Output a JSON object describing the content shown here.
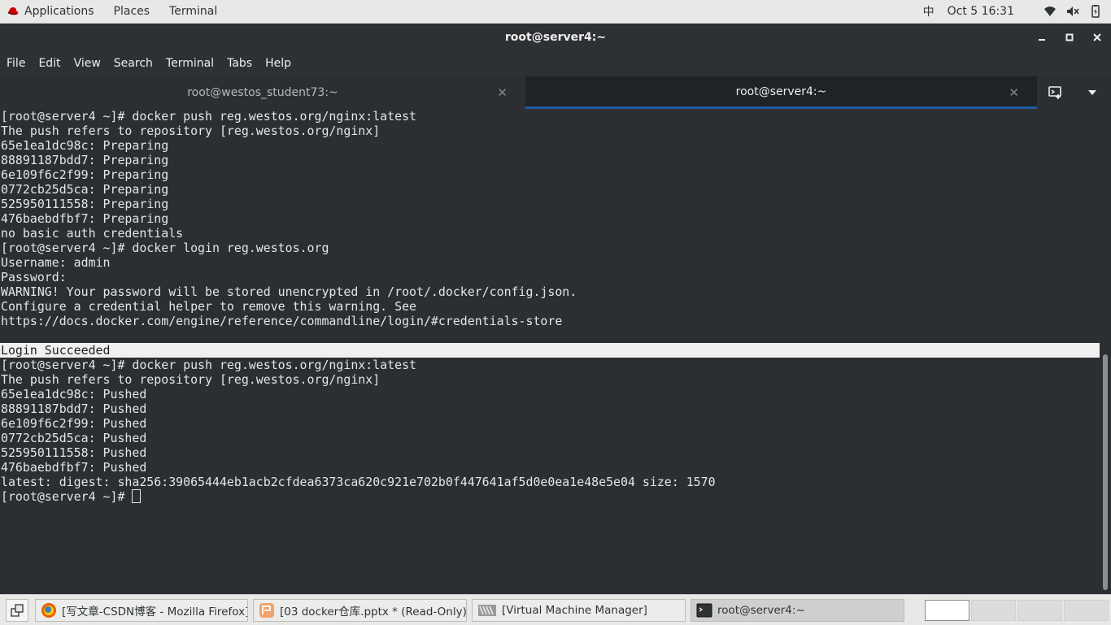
{
  "top_panel": {
    "applications": "Applications",
    "places": "Places",
    "terminal": "Terminal",
    "input_method": "中",
    "datetime": "Oct 5  16:31",
    "icons": [
      "redhat-icon",
      "wifi-icon",
      "volume-muted-icon",
      "battery-icon"
    ]
  },
  "window": {
    "title": "root@server4:~",
    "minimize": "‒",
    "maximize": "□",
    "close": "✕"
  },
  "menu": [
    "File",
    "Edit",
    "View",
    "Search",
    "Terminal",
    "Tabs",
    "Help"
  ],
  "tabs": [
    {
      "label": "root@westos_student73:~",
      "active": false
    },
    {
      "label": "root@server4:~",
      "active": true
    }
  ],
  "terminal_lines": [
    "[root@server4 ~]# docker push reg.westos.org/nginx:latest",
    "The push refers to repository [reg.westos.org/nginx]",
    "65e1ea1dc98c: Preparing",
    "88891187bdd7: Preparing",
    "6e109f6c2f99: Preparing",
    "0772cb25d5ca: Preparing",
    "525950111558: Preparing",
    "476baebdfbf7: Preparing",
    "no basic auth credentials",
    "[root@server4 ~]# docker login reg.westos.org",
    "Username: admin",
    "Password:",
    "WARNING! Your password will be stored unencrypted in /root/.docker/config.json.",
    "Configure a credential helper to remove this warning. See",
    "https://docs.docker.com/engine/reference/commandline/login/#credentials-store",
    "",
    "Login Succeeded",
    "[root@server4 ~]# docker push reg.westos.org/nginx:latest",
    "The push refers to repository [reg.westos.org/nginx]",
    "65e1ea1dc98c: Pushed",
    "88891187bdd7: Pushed",
    "6e109f6c2f99: Pushed",
    "0772cb25d5ca: Pushed",
    "525950111558: Pushed",
    "476baebdfbf7: Pushed",
    "latest: digest: sha256:39065444eb1acb2cfdea6373ca620c921e702b0f447641af5d0e0ea1e48e5e04 size: 1570"
  ],
  "prompt": "[root@server4 ~]# ",
  "taskbar": {
    "tasks": [
      {
        "label": "[写文章-CSDN博客 - Mozilla Firefox]",
        "icon": "firefox-icon",
        "active": false
      },
      {
        "label": "[03 docker仓库.pptx * (Read-Only) -...",
        "icon": "impress-icon",
        "active": false
      },
      {
        "label": "[Virtual Machine Manager]",
        "icon": "virt-manager-icon",
        "active": false
      },
      {
        "label": "root@server4:~",
        "icon": "terminal-icon",
        "active": true
      }
    ],
    "workspaces": 4,
    "active_workspace": 1
  },
  "colors": {
    "terminal_bg": "#2b2e33",
    "terminal_fg": "#e6e6e6",
    "tab_accent": "#215d9c",
    "panel_bg": "#e8e8e7"
  }
}
